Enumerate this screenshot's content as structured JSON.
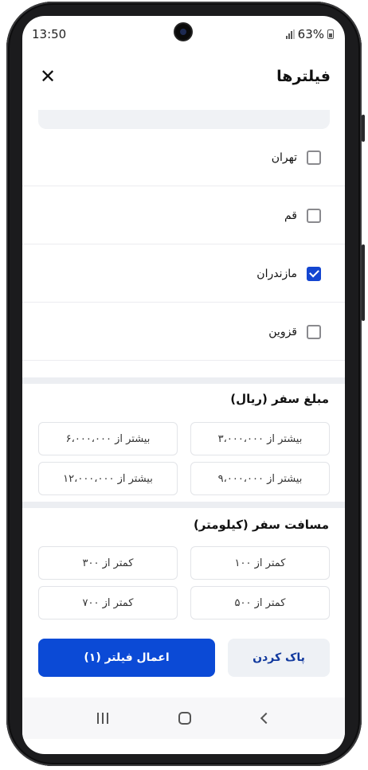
{
  "status": {
    "time": "13:50",
    "battery": "63%"
  },
  "header": {
    "title": "فیلترها"
  },
  "cities": [
    {
      "label": "تهران",
      "checked": false
    },
    {
      "label": "قم",
      "checked": false
    },
    {
      "label": "مازندران",
      "checked": true
    },
    {
      "label": "قزوین",
      "checked": false
    }
  ],
  "price": {
    "title": "مبلغ سفر (ریال)",
    "options": [
      "بیشتر از ۳،۰۰۰،۰۰۰",
      "بیشتر از ۶،۰۰۰،۰۰۰",
      "بیشتر از ۹،۰۰۰،۰۰۰",
      "بیشتر از ۱۲،۰۰۰،۰۰۰"
    ]
  },
  "distance": {
    "title": "مسافت سفر (کیلومتر)",
    "options": [
      "کمتر از ۱۰۰",
      "کمتر از ۳۰۰",
      "کمتر از ۵۰۰",
      "کمتر از ۷۰۰"
    ]
  },
  "footer": {
    "clear_label": "پاک کردن",
    "apply_label": "اعمال فیلتر (۱)"
  },
  "colors": {
    "accent": "#0b4ad6"
  }
}
